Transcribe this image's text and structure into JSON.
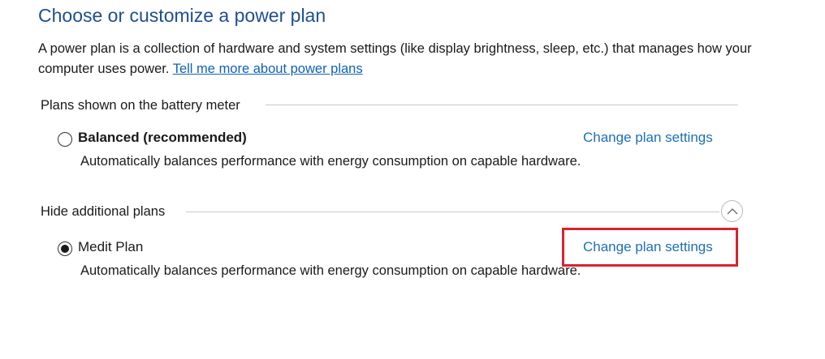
{
  "page": {
    "title": "Choose or customize a power plan",
    "description": "A power plan is a collection of hardware and system settings (like display brightness, sleep, etc.) that manages how your computer uses power.",
    "learn_more_link": "Tell me more about power plans"
  },
  "battery_meter_section": {
    "header": "Plans shown on the battery meter",
    "plans": [
      {
        "name": "Balanced (recommended)",
        "selected": false,
        "description": "Automatically balances performance with energy consumption on capable hardware.",
        "link": "Change plan settings"
      }
    ]
  },
  "additional_section": {
    "header": "Hide additional plans",
    "toggle_icon": "chevron-up-icon",
    "plans": [
      {
        "name": "Medit Plan",
        "selected": true,
        "description": "Automatically balances performance with energy consumption on capable hardware.",
        "link": "Change plan settings"
      }
    ]
  },
  "colors": {
    "title": "#1e4e92",
    "link": "#1d6fb8",
    "highlight": "#d9232f"
  }
}
